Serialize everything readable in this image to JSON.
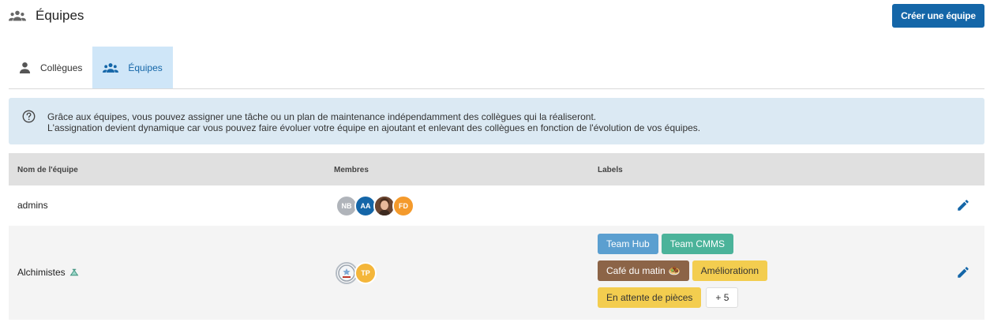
{
  "header": {
    "title": "Équipes",
    "icon": "group-icon",
    "create_button": "Créer une équipe"
  },
  "tabs": [
    {
      "label": "Collègues",
      "icon": "person-icon",
      "active": false
    },
    {
      "label": "Équipes",
      "icon": "group-icon",
      "active": true
    }
  ],
  "info": {
    "icon": "help-circle-icon",
    "line1": "Grâce aux équipes, vous pouvez assigner une tâche ou un plan de maintenance indépendamment des collègues qui la réaliseront.",
    "line2": "L'assignation devient dynamique car vous pouvez faire évoluer votre équipe en ajoutant et enlevant des collègues en fonction de l'évolution de vos équipes."
  },
  "table": {
    "columns": [
      "Nom de l'équipe",
      "Membres",
      "Labels"
    ],
    "rows": [
      {
        "name": "admins",
        "members": [
          {
            "initials": "NB",
            "color": "#b0b4ba"
          },
          {
            "initials": "AA",
            "color": "#1466a8"
          },
          {
            "initials": "",
            "color": "#8a5a3c",
            "photo": true
          },
          {
            "initials": "FD",
            "color": "#f49a2c"
          }
        ],
        "labels": []
      },
      {
        "name": "Alchimistes",
        "name_icon": "flask-icon",
        "members": [
          {
            "initials": "",
            "color": "#d8dde3",
            "logo": true
          },
          {
            "initials": "TP",
            "color": "#f4b63a"
          }
        ],
        "labels": [
          [
            {
              "text": "Team Hub",
              "bg": "#5b9fd0",
              "fg": "#ffffff"
            },
            {
              "text": "Team CMMS",
              "bg": "#4bb39a",
              "fg": "#ffffff"
            }
          ],
          [
            {
              "text": "Café du matin",
              "bg": "#8c6447",
              "fg": "#ffffff",
              "emoji": "🧆"
            },
            {
              "text": "Améliorationn",
              "bg": "#f3cd4f",
              "fg": "#333333"
            }
          ],
          [
            {
              "text": "En attente de pièces",
              "bg": "#f3cd4f",
              "fg": "#333333"
            }
          ]
        ],
        "more_labels": "+ 5"
      }
    ]
  },
  "colors": {
    "primary": "#1466a8",
    "info_bg": "#dbe9f3",
    "tab_active_bg": "#cfe6f8"
  }
}
